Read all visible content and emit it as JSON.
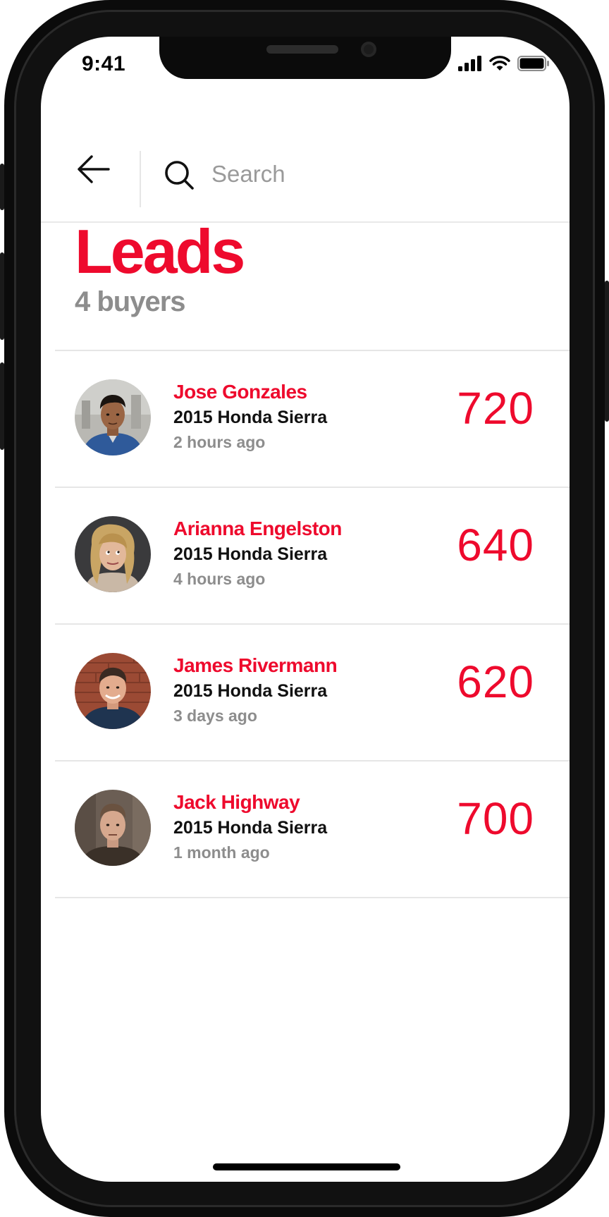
{
  "status_bar": {
    "time": "9:41"
  },
  "header": {
    "back_icon": "arrow-left-icon",
    "search_icon": "search-icon",
    "search_placeholder": "Search",
    "search_value": ""
  },
  "page": {
    "title": "Leads",
    "subtitle": "4 buyers"
  },
  "leads": [
    {
      "name": "Jose Gonzales",
      "vehicle": "2015 Honda Sierra",
      "time": "2 hours ago",
      "score": "720"
    },
    {
      "name": "Arianna Engelston",
      "vehicle": "2015 Honda Sierra",
      "time": "4 hours ago",
      "score": "640"
    },
    {
      "name": "James Rivermann",
      "vehicle": "2015 Honda Sierra",
      "time": "3 days ago",
      "score": "620"
    },
    {
      "name": "Jack Highway",
      "vehicle": "2015 Honda Sierra",
      "time": "1 month ago",
      "score": "700"
    }
  ],
  "colors": {
    "accent": "#ee0a2d",
    "secondary_text": "#8d8d8d",
    "divider": "#e6e6e6"
  }
}
